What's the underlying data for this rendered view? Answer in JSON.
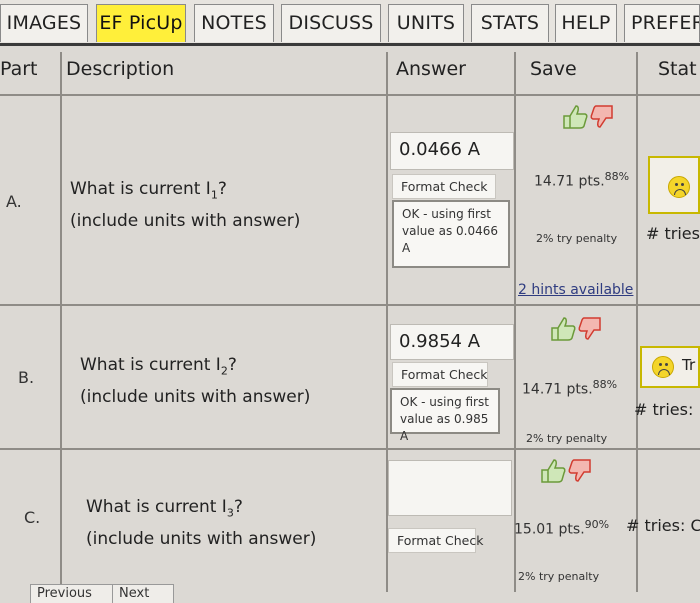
{
  "tabs": [
    {
      "label": "IMAGES",
      "active": false
    },
    {
      "label": "EF PicUp",
      "active": true
    },
    {
      "label": "NOTES",
      "active": false
    },
    {
      "label": "DISCUSS",
      "active": false
    },
    {
      "label": "UNITS",
      "active": false
    },
    {
      "label": "STATS",
      "active": false
    },
    {
      "label": "HELP",
      "active": false
    },
    {
      "label": "PREFER",
      "active": false
    }
  ],
  "table": {
    "headers": {
      "part": "Part",
      "description": "Description",
      "answer": "Answer",
      "save": "Save",
      "status": "Stat"
    }
  },
  "rows": [
    {
      "part": "A.",
      "question_line1_pre": "What is current I",
      "question_sub": "1",
      "question_line1_post": "?",
      "question_line2": "(include units with answer)",
      "answer": "0.0466 A",
      "format_check": "Format Check",
      "feedback": "OK - using first value as 0.0466 A",
      "points": "14.71 pts.",
      "percent": "88%",
      "penalty": "2% try penalty",
      "hints": "2 hints available",
      "tries": "# tries"
    },
    {
      "part": "B.",
      "question_line1_pre": "What is current I",
      "question_sub": "2",
      "question_line1_post": "?",
      "question_line2": "(include units with answer)",
      "answer": "0.9854 A",
      "format_check": "Format Check",
      "feedback": "OK - using first value as 0.985 A",
      "points": "14.71 pts.",
      "percent": "88%",
      "penalty": "2% try penalty",
      "status_text": "Tr",
      "tries": "# tries:"
    },
    {
      "part": "C.",
      "question_line1_pre": "What is current I",
      "question_sub": "3",
      "question_line1_post": "?",
      "question_line2": "(include units with answer)",
      "format_check": "Format Check",
      "points": "15.01 pts.",
      "percent": "90%",
      "penalty": "2% try penalty",
      "tries": "# tries: C"
    }
  ],
  "nav": {
    "previous": "Previous",
    "next": "Next"
  },
  "colors": {
    "active_tab": "#ffef3a",
    "thumb_up": "#7fb54a",
    "thumb_down": "#e0493c",
    "hint_link": "#2f3c80"
  }
}
